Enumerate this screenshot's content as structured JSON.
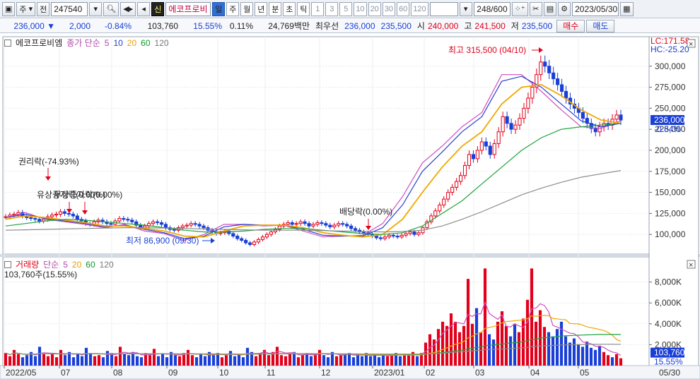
{
  "toolbar": {
    "market": "주",
    "whole": "전",
    "code": "247540",
    "shin": "신",
    "stock_name": "에코프로비",
    "periods": [
      {
        "label": "일",
        "active": true,
        "dark": true
      },
      {
        "label": "주",
        "active": false,
        "dark": true
      },
      {
        "label": "월",
        "active": false,
        "dark": true
      },
      {
        "label": "년",
        "active": false,
        "dark": true
      },
      {
        "label": "분",
        "active": false,
        "dark": true
      },
      {
        "label": "초",
        "active": false,
        "dark": true
      },
      {
        "label": "틱",
        "active": false,
        "dark": true
      },
      {
        "label": "1",
        "active": false,
        "dark": false
      },
      {
        "label": "3",
        "active": false,
        "dark": false
      },
      {
        "label": "5",
        "active": false,
        "dark": false
      },
      {
        "label": "10",
        "active": false,
        "dark": false
      },
      {
        "label": "20",
        "active": false,
        "dark": false
      },
      {
        "label": "30",
        "active": false,
        "dark": false
      },
      {
        "label": "60",
        "active": false,
        "dark": false
      },
      {
        "label": "120",
        "active": false,
        "dark": false
      }
    ],
    "count": "248/600",
    "date": "2023/05/30"
  },
  "quote": {
    "price": "236,000",
    "change": "2,000",
    "pct": "-0.84%",
    "volume": "103,760",
    "turnover": "15.55%",
    "ratio": "0.11%",
    "amount": "24,769백만",
    "best_label": "최우선",
    "best_ask": "236,000",
    "best_bid": "235,500",
    "open_label": "시",
    "open": "240,000",
    "high_label": "고",
    "high": "241,500",
    "low_label": "저",
    "low": "235,500",
    "buy": "매수",
    "sell": "매도"
  },
  "price_panel": {
    "stock_label": "에코프로비엠",
    "legend_label": "종가 단순",
    "ma_periods": [
      "5",
      "10",
      "20",
      "60",
      "120"
    ],
    "lc": "LC:171.58",
    "hc": "HC:-25.20",
    "current_tag": "236,000",
    "current_pct": "-0.84%",
    "annotations": {
      "high": "최고 315,500 (04/10)",
      "low": "최저 86,900 (09/30)",
      "rights": "권리락(-74.93%)",
      "bonus": "유상증자락(0.00%)",
      "bonus2": "무상증자락(0.00%)",
      "dividend": "배당락(0.00%)"
    }
  },
  "volume_panel": {
    "label": "거래량",
    "legend_label": "단순",
    "ma_periods": [
      "5",
      "20",
      "60",
      "120"
    ],
    "current": "103,760주(15.55%)",
    "tag_value": "103,760",
    "tag_pct": "15.55%"
  },
  "chart_data": [
    {
      "type": "candlestick",
      "title": "",
      "ylim": [
        80000,
        330000
      ],
      "y_ticks": [
        "100,000",
        "125,000",
        "150,000",
        "175,000",
        "200,000",
        "225,000",
        "250,000",
        "275,000",
        "300,000"
      ],
      "y_values": [
        100000,
        125000,
        150000,
        175000,
        200000,
        225000,
        250000,
        275000,
        300000
      ],
      "x_ticks": [
        "2022/05",
        "07",
        "08",
        "09",
        "10",
        "11",
        "12",
        "2023/01",
        "02",
        "03",
        "04",
        "05",
        "05/30"
      ],
      "series": [
        {
          "name": "종가",
          "values": [
            121000,
            123000,
            124000,
            126000,
            122000,
            120000,
            119000,
            118000,
            116000,
            118000,
            121000,
            123000,
            124000,
            127000,
            125000,
            124000,
            122000,
            118000,
            116000,
            113000,
            112000,
            115000,
            117000,
            115000,
            113000,
            112000,
            116000,
            119000,
            118000,
            117000,
            115000,
            111000,
            108000,
            110000,
            113000,
            115000,
            114000,
            112000,
            108000,
            106000,
            105000,
            108000,
            110000,
            111000,
            113000,
            112000,
            110000,
            108000,
            105000,
            103000,
            101000,
            102000,
            104000,
            101000,
            98000,
            95000,
            93000,
            90000,
            88000,
            91000,
            94000,
            97000,
            100000,
            103000,
            106000,
            110000,
            112000,
            114000,
            112000,
            113000,
            115000,
            113000,
            110000,
            112000,
            114000,
            113000,
            111000,
            109000,
            111000,
            113000,
            112000,
            110000,
            107000,
            105000,
            103000,
            102000,
            100000,
            98000,
            96000,
            95000,
            97000,
            99000,
            98000,
            97000,
            99000,
            101000,
            103000,
            100000,
            102000,
            108000,
            115000,
            122000,
            128000,
            135000,
            142000,
            150000,
            156000,
            163000,
            170000,
            182000,
            195000,
            190000,
            200000,
            210000,
            205000,
            195000,
            208000,
            222000,
            240000,
            232000,
            225000,
            230000,
            238000,
            250000,
            262000,
            275000,
            290000,
            305000,
            300000,
            292000,
            285000,
            278000,
            270000,
            262000,
            255000,
            250000,
            245000,
            238000,
            232000,
            226000,
            222000,
            228000,
            232000,
            230000,
            237000,
            242000,
            236000
          ]
        },
        {
          "name": "5",
          "values": [
            120000,
            126000,
            118000,
            115000,
            112000,
            108000,
            112000,
            104000,
            101000,
            93000,
            100000,
            112000,
            112000,
            110000,
            111000,
            104000,
            97000,
            98000,
            99000,
            113000,
            145000,
            185000,
            205000,
            228000,
            245000,
            290000,
            290000,
            270000,
            248000,
            228000,
            226000,
            235000
          ]
        },
        {
          "name": "10",
          "values": [
            120000,
            124000,
            119000,
            116000,
            113000,
            109000,
            111000,
            106000,
            102000,
            95000,
            98000,
            109000,
            112000,
            111000,
            111000,
            106000,
            99000,
            98000,
            98000,
            108000,
            135000,
            175000,
            198000,
            222000,
            240000,
            282000,
            288000,
            275000,
            255000,
            235000,
            228000,
            232000
          ]
        },
        {
          "name": "20",
          "values": [
            118000,
            122000,
            120000,
            117000,
            114000,
            110000,
            110000,
            107000,
            104000,
            98000,
            97000,
            104000,
            110000,
            111000,
            111000,
            108000,
            102000,
            99000,
            97000,
            100000,
            118000,
            150000,
            180000,
            205000,
            222000,
            255000,
            275000,
            278000,
            265000,
            248000,
            236000,
            232000
          ]
        },
        {
          "name": "60",
          "values": [
            110000,
            113000,
            116000,
            118000,
            117000,
            115000,
            113000,
            111000,
            108000,
            105000,
            103000,
            103000,
            104000,
            106000,
            107000,
            107000,
            105000,
            103000,
            101000,
            100000,
            102000,
            110000,
            125000,
            140000,
            160000,
            180000,
            200000,
            215000,
            225000,
            228000,
            230000,
            232000
          ]
        },
        {
          "name": "120",
          "values": [
            105000,
            105500,
            106000,
            106500,
            107000,
            107500,
            108000,
            108000,
            107500,
            107000,
            106500,
            106000,
            105500,
            105000,
            105000,
            105000,
            104500,
            104000,
            103500,
            103000,
            103500,
            105000,
            110000,
            118000,
            127000,
            137000,
            147000,
            155000,
            162000,
            168000,
            172000,
            176000
          ]
        }
      ]
    },
    {
      "type": "bar",
      "title": "",
      "ylim": [
        0,
        10000000
      ],
      "y_ticks": [
        "2,000K",
        "4,000K",
        "6,000K",
        "8,000K"
      ],
      "y_values": [
        2000000,
        4000000,
        6000000,
        8000000
      ],
      "series": [
        {
          "name": "거래량",
          "values": [
            1200000,
            900000,
            1500000,
            1100000,
            800000,
            1000000,
            1300000,
            900000,
            1800000,
            1100000,
            900000,
            1200000,
            800000,
            1500000,
            1000000,
            1300000,
            800000,
            1100000,
            900000,
            1700000,
            1200000,
            900000,
            1000000,
            800000,
            1400000,
            1200000,
            900000,
            1800000,
            1100000,
            1000000,
            1300000,
            900000,
            800000,
            1200000,
            1000000,
            1600000,
            900000,
            1100000,
            800000,
            1300000,
            1000000,
            900000,
            1200000,
            1500000,
            1000000,
            800000,
            1100000,
            900000,
            1300000,
            1000000,
            1200000,
            800000,
            1000000,
            1400000,
            900000,
            1100000,
            800000,
            1700000,
            1300000,
            900000,
            1200000,
            1500000,
            1000000,
            1300000,
            1800000,
            1000000,
            900000,
            1100000,
            1300000,
            800000,
            1000000,
            1200000,
            900000,
            1100000,
            1500000,
            1000000,
            800000,
            1300000,
            900000,
            1000000,
            1100000,
            1200000,
            800000,
            1000000,
            900000,
            1200000,
            900000,
            1000000,
            800000,
            1100000,
            900000,
            1000000,
            1200000,
            900000,
            1000000,
            1100000,
            1300000,
            900000,
            1200000,
            2200000,
            3000000,
            2500000,
            3500000,
            4200000,
            3800000,
            5000000,
            4200000,
            3200000,
            3800000,
            8300000,
            4000000,
            5500000,
            3200000,
            9300000,
            3000000,
            2500000,
            4200000,
            5200000,
            3800000,
            2800000,
            4000000,
            3200000,
            4500000,
            6300000,
            9300000,
            4200000,
            5300000,
            3700000,
            3200000,
            2800000,
            3500000,
            4200000,
            2800000,
            2200000,
            2600000,
            2000000,
            1800000,
            2300000,
            1700000,
            1500000,
            1900000,
            1300000,
            1000000,
            800000,
            1100000,
            700000
          ]
        }
      ]
    }
  ]
}
